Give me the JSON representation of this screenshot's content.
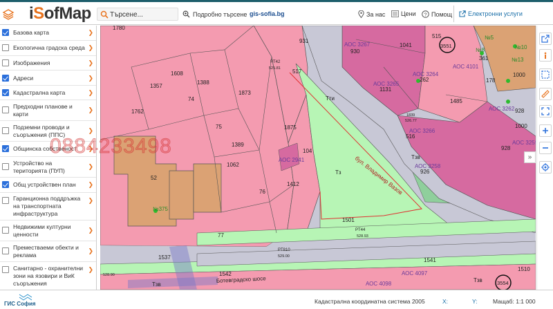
{
  "header": {
    "logo_prefix": "i",
    "logo_o": "S",
    "logo_rest": "ofMap",
    "search_placeholder": "Търсене...",
    "advanced_search": "Подробно търсене",
    "site_link": "gis-sofia.bg",
    "nav": {
      "about": "За нас",
      "prices": "Цени",
      "help": "Помощ",
      "services": "Електронни услуги"
    }
  },
  "sidebar": {
    "layers": [
      {
        "label": "Базова карта",
        "checked": true
      },
      {
        "label": "Екологична градска среда",
        "checked": false
      },
      {
        "label": "Изображения",
        "checked": false
      },
      {
        "label": "Адреси",
        "checked": true
      },
      {
        "label": "Кадастрална карта",
        "checked": true
      },
      {
        "label": "Предходни планове и карти",
        "checked": false
      },
      {
        "label": "Подземни проводи и съоръжения (ППС)",
        "checked": false
      },
      {
        "label": "Общинска собственост",
        "checked": true
      },
      {
        "label": "Устройство на територията (ПУП)",
        "checked": false
      },
      {
        "label": "Общ устройствен план",
        "checked": true
      },
      {
        "label": "Гаранционна поддръжка на транспортната инфраструктура",
        "checked": false
      },
      {
        "label": "Недвижими културни ценности",
        "checked": false
      },
      {
        "label": "Преместваеми обекти и реклама",
        "checked": false
      },
      {
        "label": "Санитарно - охранителни зони на язовири и ВиК съоръжения",
        "checked": false
      }
    ]
  },
  "map": {
    "watermark": "0884233498",
    "labels": {
      "p1780": "1780",
      "p931": "931",
      "p1041": "1041",
      "p3551": "3551",
      "p515": "515",
      "p1608": "1608",
      "p1357": "1357",
      "p1388": "1388",
      "p1873": "1873",
      "p74": "74",
      "p1762": "1762",
      "p517": "517",
      "pt42": "PT42",
      "pt42v": "525.81",
      "aoc3267": "АОС 3267",
      "p930": "930",
      "aoc3265": "АОС 3265",
      "p1131": "1131",
      "aoc3264": "АОС 3264",
      "p262": "262",
      "p1485": "1485",
      "aoc4101": "АОС 4101",
      "tti": "Тти",
      "p75": "75",
      "p1875": "1875",
      "p1389": "1389",
      "p1839": "1839",
      "p1839v": "526.77",
      "aoc3266": "АОС 3266",
      "p516": "516",
      "p104": "104",
      "aoc2941": "АОС 2941",
      "p1062": "1062",
      "p52": "52",
      "tz1": "Тз",
      "tz2": "Тзв",
      "street": "бул. Владимир Вазов",
      "aoc3258": "АОС 3258",
      "p926": "926",
      "p928": "928",
      "aoc3259": "АОС 3259",
      "p1412": "1412",
      "p76": "76",
      "n375": "№375",
      "p1501": "1501",
      "pt44": "PT44",
      "pt44v": "528.93",
      "pt810": "PT810",
      "pt810v": "529.00",
      "p77": "77",
      "p1537": "1537",
      "p1541": "1541",
      "p1510": "1510",
      "p1542": "1542",
      "road": "Ботевградско шосе",
      "aoc4098": "АОС 4098",
      "aoc4097": "АОС 4097",
      "tzv3": "Тзв",
      "tzv4": "Тзв",
      "p3554": "3554",
      "p52890": "528.90",
      "p361": "361",
      "p178": "178",
      "n8": "№8",
      "n5": "№5",
      "n10": "№10",
      "n13": "№13",
      "p1000": "1000",
      "p928b": "928",
      "aoc3262": "АОС 3262",
      "p1000b": "1000"
    }
  },
  "footer": {
    "org": "ГИС София",
    "coord_system": "Кадастрална координатна система 2005",
    "x_label": "X:",
    "y_label": "Y:",
    "scale": "Мащаб: 1:1 000"
  },
  "colors": {
    "accent": "#e8731e",
    "pink": "#f49bb0",
    "magenta": "#d66aa0",
    "green": "#b7f5b5",
    "orange_building": "#dba274",
    "road": "#c8c8d6",
    "checkbox": "#2a6fdb"
  }
}
